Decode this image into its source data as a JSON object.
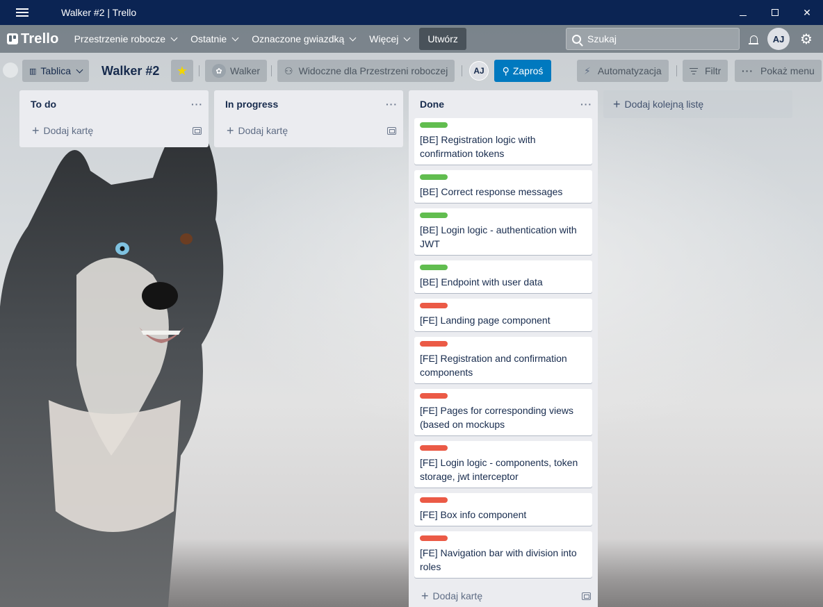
{
  "window": {
    "title": "Walker #2 | Trello"
  },
  "appnav": {
    "logo": "Trello",
    "items": [
      "Przestrzenie robocze",
      "Ostatnie",
      "Oznaczone gwiazdką",
      "Więcej"
    ],
    "create": "Utwórz",
    "search_placeholder": "Szukaj",
    "avatar": "AJ"
  },
  "board": {
    "view": "Tablica",
    "title": "Walker #2",
    "workspace": "Walker",
    "visibility": "Widoczne dla Przestrzeni roboczej",
    "member": "AJ",
    "invite": "Zaproś",
    "automation": "Automatyzacja",
    "filter": "Filtr",
    "menu": "Pokaż menu",
    "add_list": "Dodaj kolejną listę",
    "add_card": "Dodaj kartę"
  },
  "colors": {
    "green": "#61bd4f",
    "red": "#eb5a46",
    "invite": "#0079bf",
    "star": "#f2d600"
  },
  "lists": [
    {
      "title": "To do",
      "cards": []
    },
    {
      "title": "In progress",
      "cards": []
    },
    {
      "title": "Done",
      "cards": [
        {
          "label": "green",
          "title": "[BE] Registration logic with confirmation tokens"
        },
        {
          "label": "green",
          "title": "[BE] Correct response messages"
        },
        {
          "label": "green",
          "title": "[BE] Login logic - authentication with JWT"
        },
        {
          "label": "green",
          "title": "[BE] Endpoint with user data"
        },
        {
          "label": "red",
          "title": "[FE] Landing page component"
        },
        {
          "label": "red",
          "title": "[FE] Registration and confirmation components"
        },
        {
          "label": "red",
          "title": "[FE] Pages for corresponding views (based on mockups"
        },
        {
          "label": "red",
          "title": "[FE] Login logic - components, token storage, jwt interceptor"
        },
        {
          "label": "red",
          "title": "[FE] Box info component"
        },
        {
          "label": "red",
          "title": "[FE] Navigation bar with division into roles"
        }
      ]
    }
  ]
}
